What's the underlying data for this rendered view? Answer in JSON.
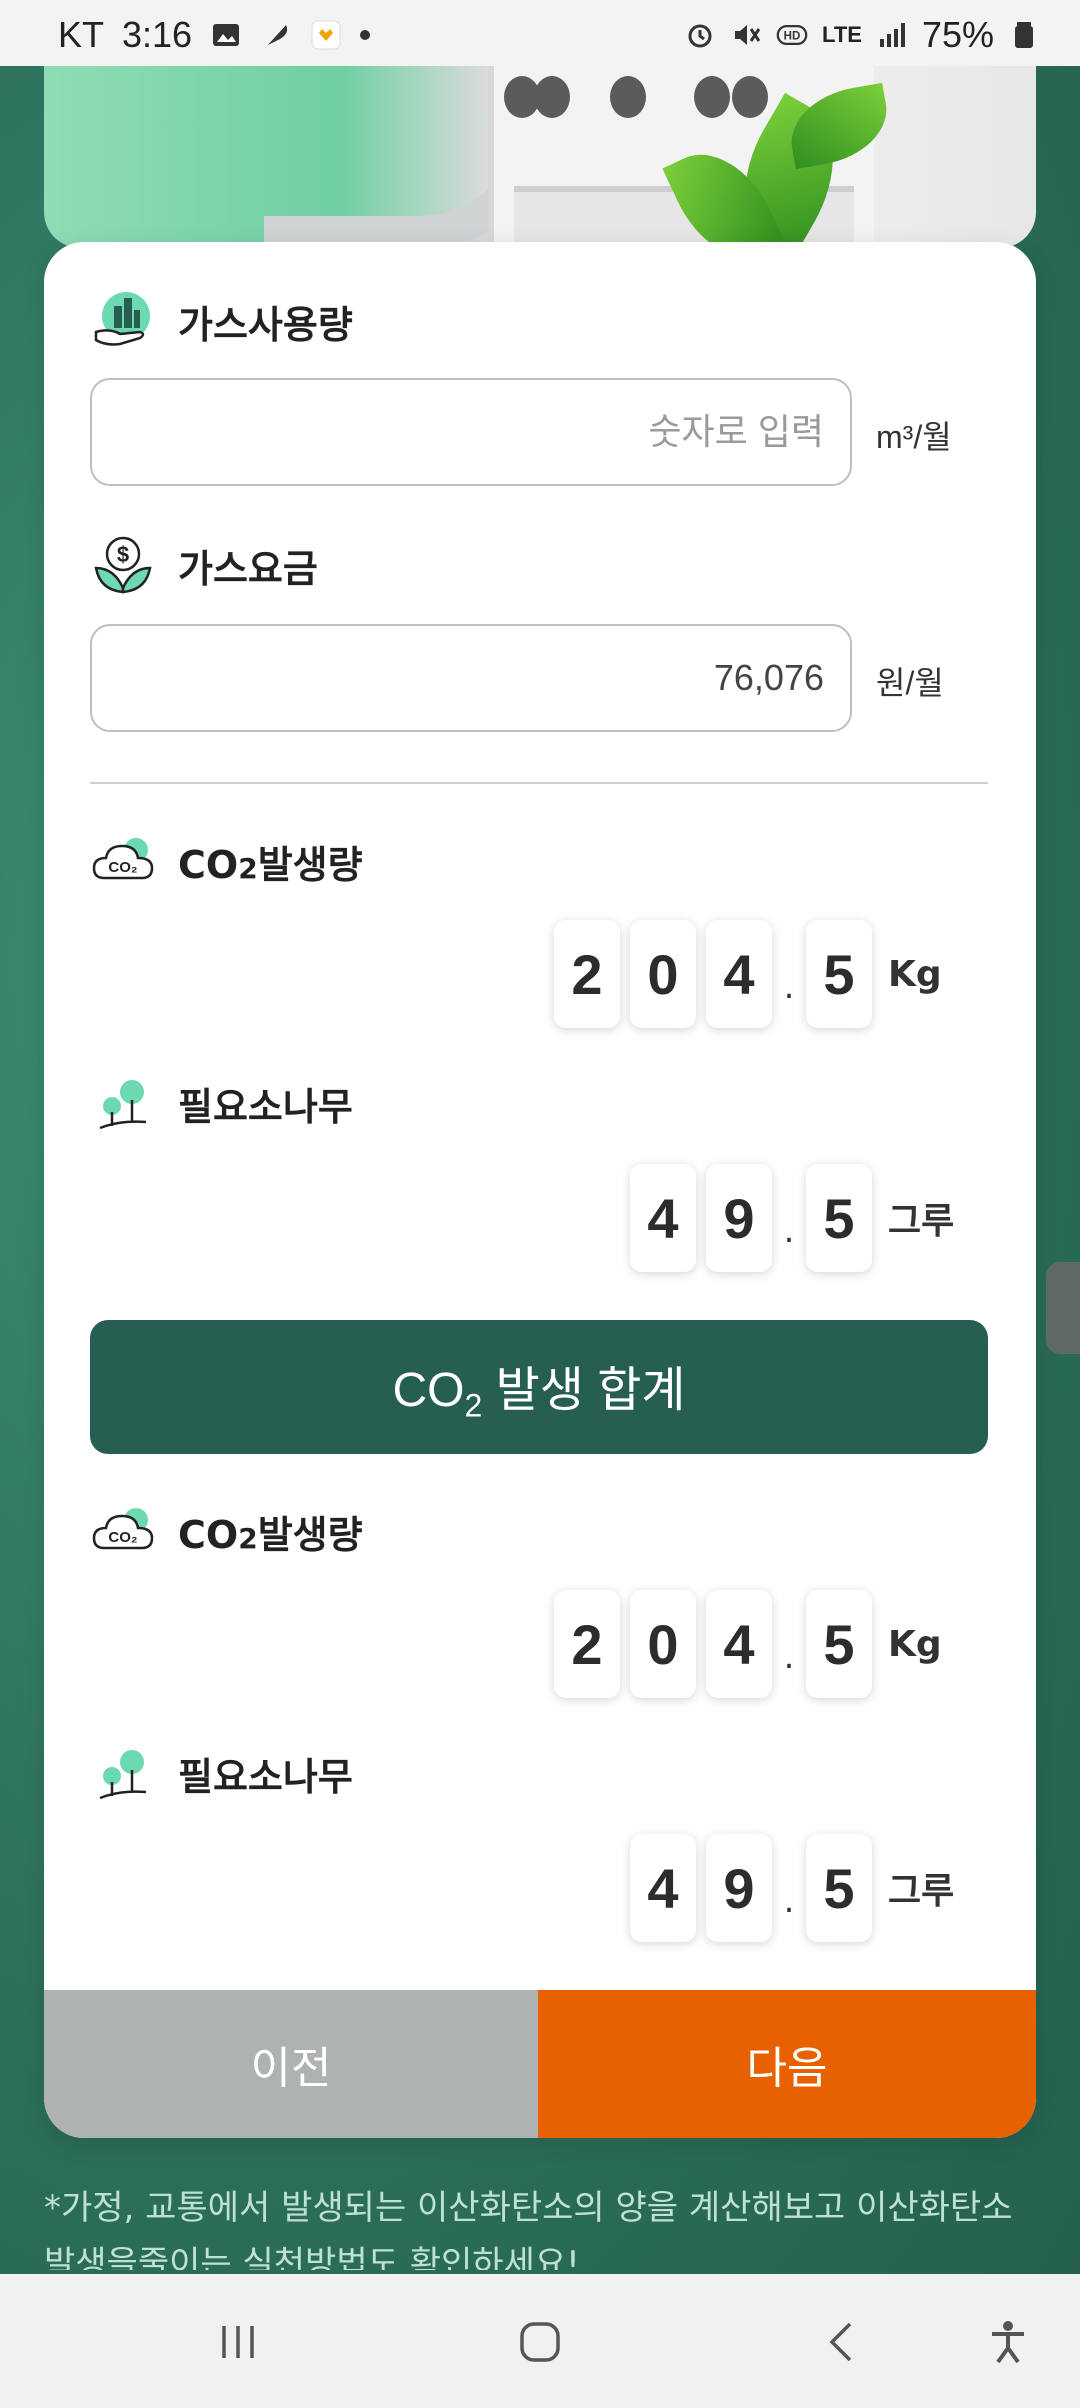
{
  "status_bar": {
    "carrier": "KT",
    "time": "3:16",
    "network": "LTE",
    "battery": "75%"
  },
  "form": {
    "gas_usage": {
      "label": "가스사용량",
      "placeholder": "숫자로 입력",
      "value": "",
      "unit": "m³/월"
    },
    "gas_bill": {
      "label": "가스요금",
      "value": "76,076",
      "unit": "원/월"
    }
  },
  "results": {
    "co2": {
      "label_main": "CO",
      "label_sub": "2",
      "label_rest": "발생량",
      "digits": [
        "2",
        "0",
        "4",
        "5"
      ],
      "decimal": ".",
      "unit": "Kg"
    },
    "trees": {
      "label": "필요소나무",
      "digits": [
        "4",
        "9",
        "5"
      ],
      "decimal": ".",
      "unit": "그루"
    }
  },
  "sum_button": {
    "co": "CO",
    "sub": "2",
    "rest": " 발생 합계"
  },
  "totals": {
    "co2": {
      "label_main": "CO",
      "label_sub": "2",
      "label_rest": "발생량",
      "digits": [
        "2",
        "0",
        "4",
        "5"
      ],
      "decimal": ".",
      "unit": "Kg"
    },
    "trees": {
      "label": "필요소나무",
      "digits": [
        "4",
        "9",
        "5"
      ],
      "decimal": ".",
      "unit": "그루"
    }
  },
  "nav_buttons": {
    "prev": "이전",
    "next": "다음"
  },
  "footnote": "*가정, 교통에서 발생되는 이산화탄소의 양을 계산해보고 이산화탄소 발생을줄이는 실천방법도 확인하세요!",
  "colors": {
    "background": "#2f7a63",
    "sum_button": "#265e51",
    "next_button": "#e86100",
    "prev_button": "#aeb3b1"
  },
  "icons": {
    "gas_usage": "building-hand-icon",
    "gas_bill": "dollar-leaf-icon",
    "co2": "co2-cloud-icon",
    "trees": "trees-icon"
  }
}
